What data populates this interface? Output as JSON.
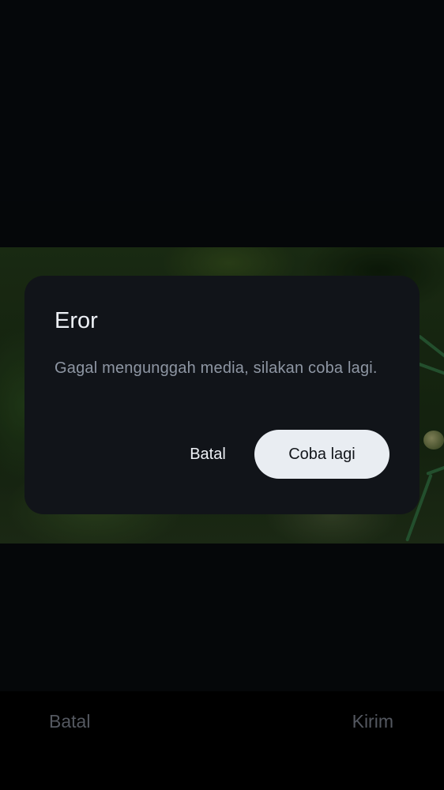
{
  "dialog": {
    "title": "Eror",
    "message": "Gagal mengunggah media, silakan coba lagi.",
    "cancel_label": "Batal",
    "retry_label": "Coba lagi"
  },
  "bottom_bar": {
    "cancel_label": "Batal",
    "send_label": "Kirim"
  },
  "colors": {
    "dialog_background": "#111419",
    "primary_button": "#e9edf2",
    "muted_text": "#545860"
  }
}
